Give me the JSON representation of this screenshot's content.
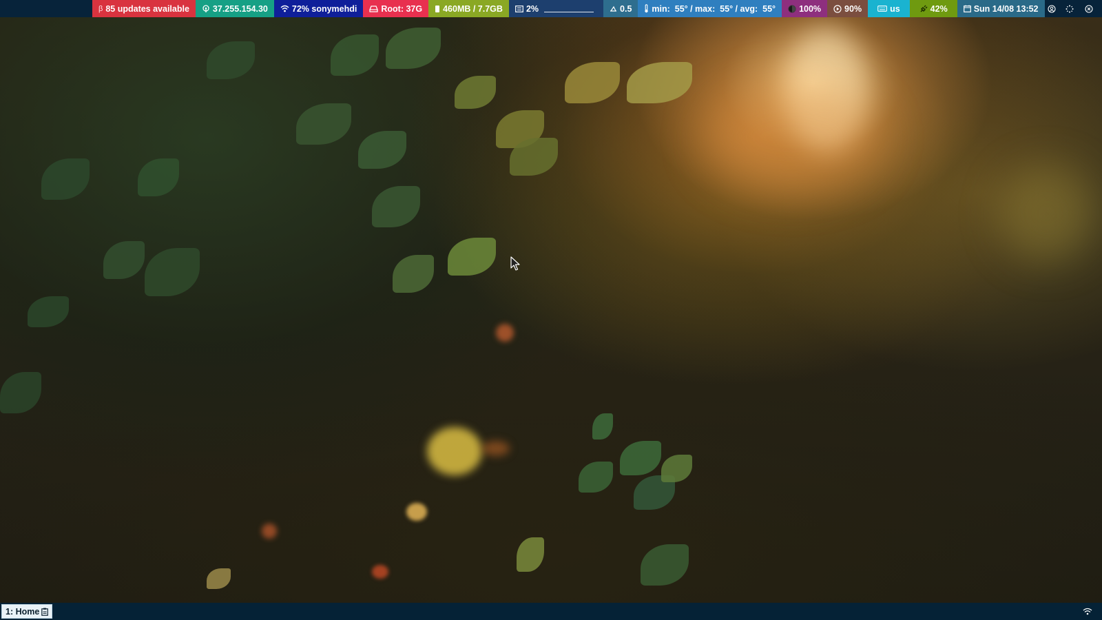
{
  "colors": {
    "bar_bg": "#07233a",
    "bottom_bg": "#052236",
    "updates": "#d9333f",
    "ip": "#16a085",
    "wifi": "#0f1f9a",
    "root": "#e8304f",
    "memory": "#8aa824",
    "cpu": "#1d3f6e",
    "load": "#2e6e8e",
    "temp": "#2f7fbf",
    "brightness": "#8e2f7e",
    "volume": "#7b4e3f",
    "keyboard": "#1ab3d0",
    "battery": "#6f9a10",
    "date": "#2a6a88"
  },
  "topbar": {
    "updates": {
      "icon": "beta-icon",
      "icon_glyph": "β",
      "label": "85 updates available"
    },
    "ip": {
      "icon": "network-icon",
      "label": "37.255.154.30"
    },
    "wifi": {
      "icon": "wifi-icon",
      "label": "72% sonymehdi"
    },
    "root": {
      "icon": "hdd-icon",
      "label": "Root: 37G"
    },
    "memory": {
      "icon": "memory-icon",
      "label": "460MB / 7.7GB"
    },
    "cpu": {
      "icon": "cpu-icon",
      "label": "2%",
      "usage_fraction": 0.02
    },
    "load": {
      "icon": "load-icon",
      "label": "0.5"
    },
    "temperature": {
      "icon": "thermometer-icon",
      "label": "min:  55° / max:  55° / avg:  55°"
    },
    "brightness": {
      "icon": "brightness-icon",
      "label": "100%"
    },
    "volume": {
      "icon": "play-icon",
      "label": "90%"
    },
    "keyboard": {
      "icon": "keyboard-icon",
      "label": "us"
    },
    "battery": {
      "icon": "plug-icon",
      "label": "42%"
    },
    "date": {
      "icon": "calendar-icon",
      "label": "Sun 14/08 13:52"
    },
    "tray": [
      "user-circle-icon",
      "spinner-icon",
      "close-circle-icon"
    ]
  },
  "bottombar": {
    "workspace": {
      "label": "1: Home",
      "icon": "clipboard-icon"
    },
    "tray_icon": "wifi-icon"
  }
}
